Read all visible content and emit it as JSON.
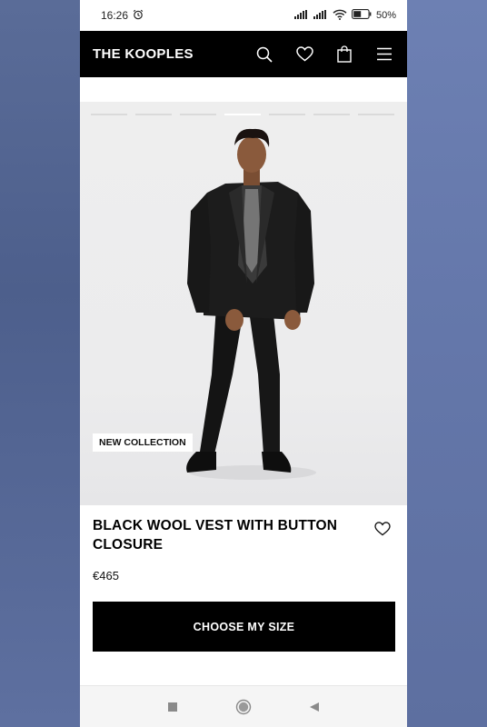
{
  "status_bar": {
    "time": "16:26",
    "battery_text": "50",
    "battery_unit": "%"
  },
  "header": {
    "logo": "THE KOOPLES",
    "icons": [
      "search-icon",
      "heart-icon",
      "shopping-bag-icon",
      "menu-icon"
    ]
  },
  "gallery": {
    "image_count": 7,
    "active_index": 3,
    "badge": "NEW COLLECTION"
  },
  "product": {
    "title": "BLACK WOOL VEST WITH BUTTON CLOSURE",
    "price": "€465"
  },
  "cta": {
    "label": "CHOOSE MY SIZE"
  },
  "colors": {
    "header_bg": "#000000",
    "cta_bg": "#000000",
    "page_bg": "#ffffff"
  },
  "system_nav": [
    "recent-apps-button",
    "home-button",
    "back-button"
  ]
}
